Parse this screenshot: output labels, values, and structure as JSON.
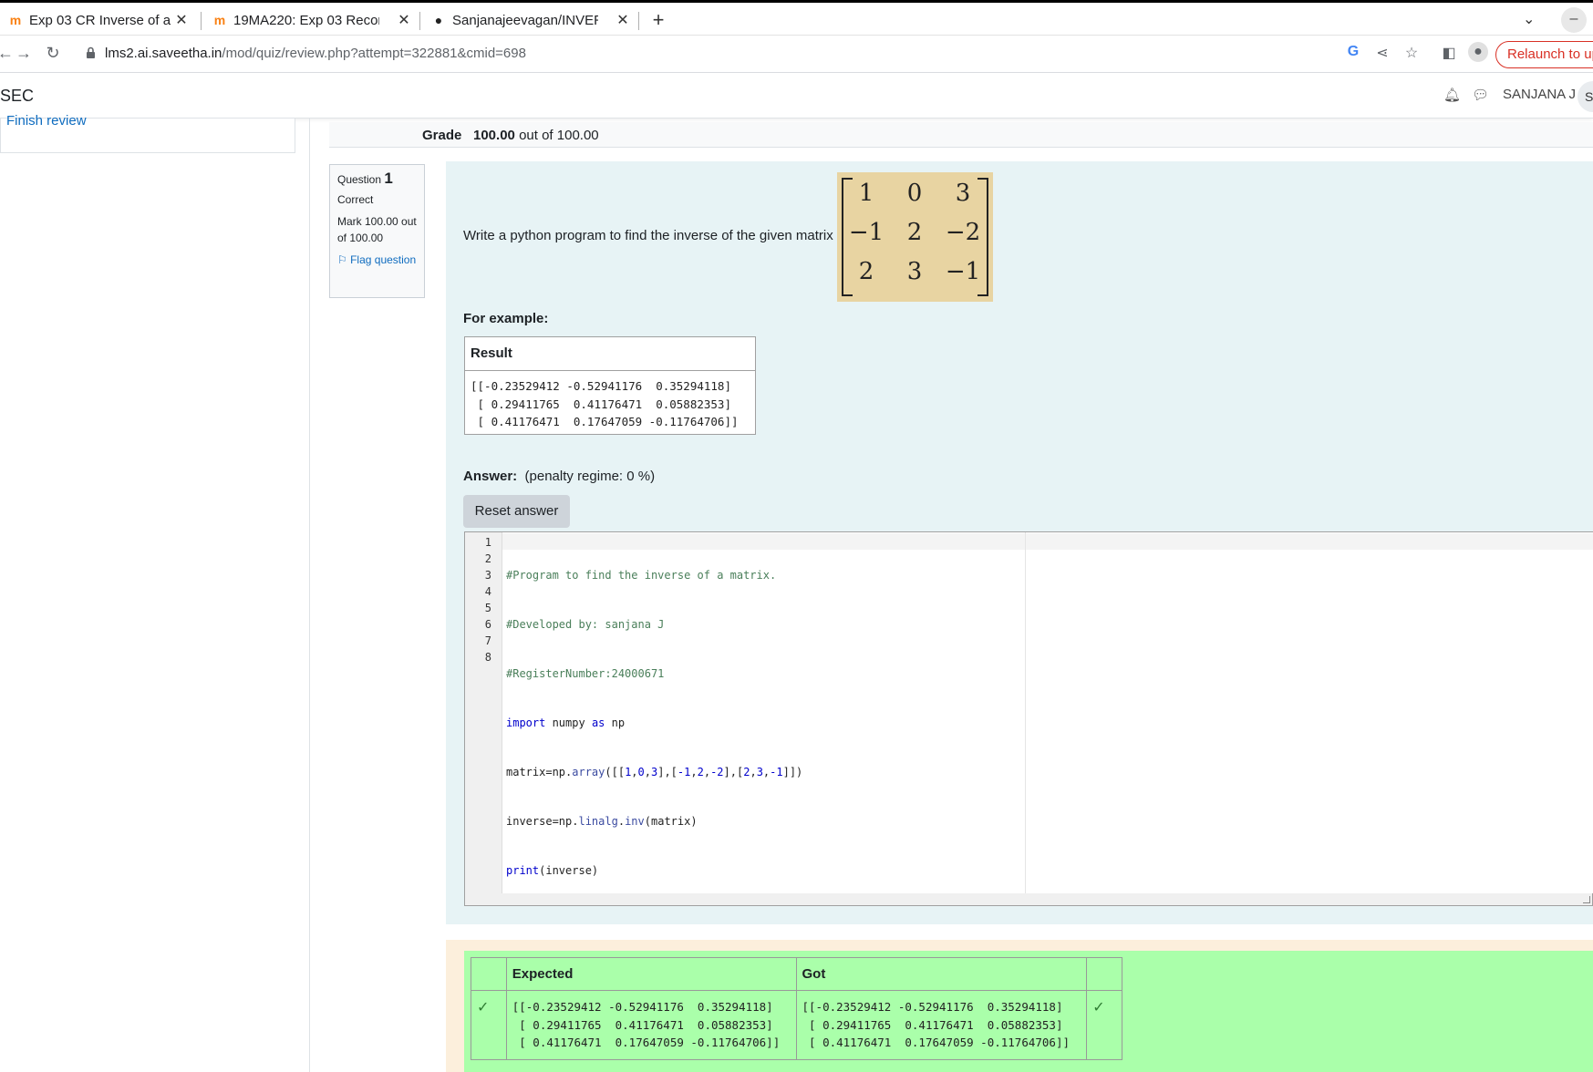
{
  "browser": {
    "tabs": [
      {
        "title": "Exp 03 CR Inverse of a mat",
        "favicon": "moodle-icon",
        "active": true
      },
      {
        "title": "19MA220: Exp 03 Record-",
        "favicon": "moodle-icon",
        "active": false
      },
      {
        "title": "Sanjanajeevagan/INVERS",
        "favicon": "github-icon",
        "active": false
      }
    ],
    "new_tab": "+",
    "url_host": "lms2.ai.saveetha.in",
    "url_path": "/mod/quiz/review.php?attempt=322881&cmid=698",
    "relaunch_label": "Relaunch to up"
  },
  "site": {
    "brand": "SEC",
    "user_name": "SANJANA J",
    "avatar_initial": "S"
  },
  "nav": {
    "finish_review": "Finish review"
  },
  "grade": {
    "label": "Grade",
    "value": "100.00",
    "suffix": "out of 100.00"
  },
  "question_info": {
    "question_label": "Question",
    "number": "1",
    "state": "Correct",
    "mark": "Mark 100.00 out of 100.00",
    "flag": "Flag question"
  },
  "question": {
    "text": "Write a python program to find the inverse of the given matrix",
    "matrix": [
      [
        "1",
        "0",
        "3"
      ],
      [
        "−1",
        "2",
        "−2"
      ],
      [
        "2",
        "3",
        "−1"
      ]
    ],
    "for_example": "For example:",
    "result_header": "Result",
    "result_text": "[[-0.23529412 -0.52941176  0.35294118]\n [ 0.29411765  0.41176471  0.05882353]\n [ 0.41176471  0.17647059 -0.11764706]]",
    "answer_label": "Answer:",
    "penalty": "(penalty regime: 0 %)",
    "reset_label": "Reset answer"
  },
  "editor": {
    "line_numbers": "1\n2\n3\n4\n5\n6\n7\n8",
    "lines": [
      "#Program to find the inverse of a matrix.",
      "#Developed by: sanjana J",
      "#RegisterNumber:24000671",
      "import numpy as np",
      "matrix=np.array([[1,0,3],[-1,2,-2],[2,3,-1]])",
      "inverse=np.linalg.inv(matrix)",
      "print(inverse)",
      ""
    ]
  },
  "feedback": {
    "expected_header": "Expected",
    "got_header": "Got",
    "expected": "[[-0.23529412 -0.52941176  0.35294118]\n [ 0.29411765  0.41176471  0.05882353]\n [ 0.41176471  0.17647059 -0.11764706]]",
    "got": "[[-0.23529412 -0.52941176  0.35294118]\n [ 0.29411765  0.41176471  0.05882353]\n [ 0.41176471  0.17647059 -0.11764706]]",
    "pass_icon": "check-icon"
  },
  "colors": {
    "question_bg": "#e7f3f5",
    "feedback_bg": "#fcefdc",
    "pass_bg": "#aaffaa",
    "link": "#0f6cbf"
  }
}
